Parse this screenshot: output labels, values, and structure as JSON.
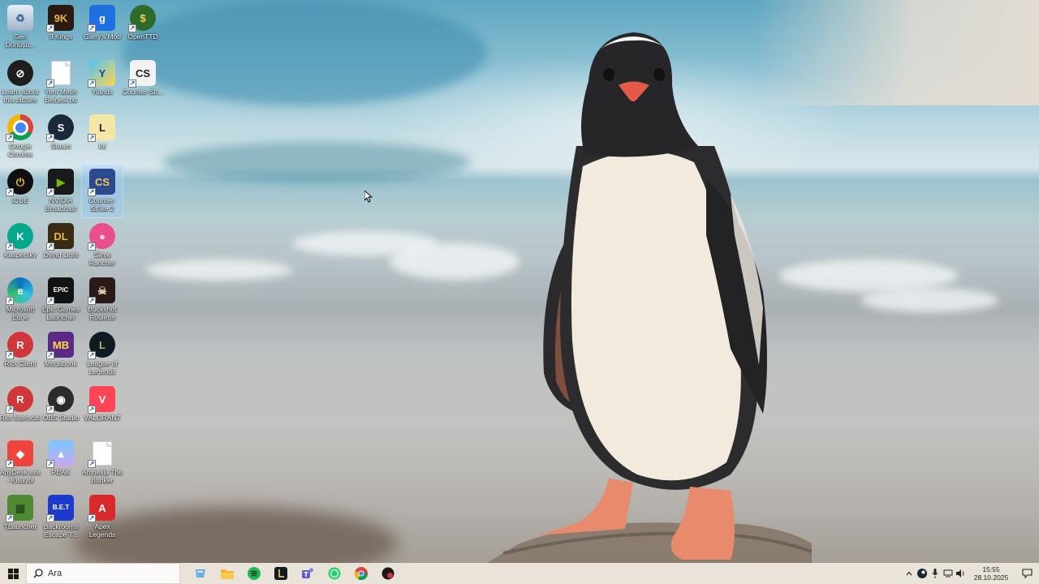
{
  "desktop": {
    "icons": [
      {
        "label": "Geri Dönüşü...",
        "icon": "recycle-bin-icon"
      },
      {
        "label": "9 Kings",
        "icon": "9-kings-icon"
      },
      {
        "label": "Garry's Mod",
        "icon": "garrys-mod-icon"
      },
      {
        "label": "OpenTTD",
        "icon": "openttd-icon"
      },
      {
        "label": "Learn about this picture",
        "icon": "learn-about-picture-icon"
      },
      {
        "label": "Yeni Metin Belgesi.txt",
        "icon": "text-document-icon"
      },
      {
        "label": "Ylands",
        "icon": "ylands-icon"
      },
      {
        "label": "Counter-Str...",
        "icon": "counter-strike-icon"
      },
      {
        "label": "Google Chrome",
        "icon": "chrome-icon"
      },
      {
        "label": "Steam",
        "icon": "steam-icon"
      },
      {
        "label": "lol",
        "icon": "lol-folder-icon"
      },
      {
        "label": "iCUE",
        "icon": "icue-icon"
      },
      {
        "label": "NVIDIA Broadcast",
        "icon": "nvidia-broadcast-icon"
      },
      {
        "label": "Counter-Strike 2",
        "icon": "counter-strike-2-icon"
      },
      {
        "label": "Kaspersky",
        "icon": "kaspersky-icon"
      },
      {
        "label": "Dying Light",
        "icon": "dying-light-icon"
      },
      {
        "label": "Slime Rancher",
        "icon": "slime-rancher-icon"
      },
      {
        "label": "Microsoft Edge",
        "icon": "edge-icon"
      },
      {
        "label": "Epic Games Launcher",
        "icon": "epic-games-icon"
      },
      {
        "label": "Buckshot Roulette",
        "icon": "buckshot-roulette-icon"
      },
      {
        "label": "Riot Client",
        "icon": "riot-client-icon"
      },
      {
        "label": "Megabonk",
        "icon": "megabonk-icon"
      },
      {
        "label": "League of Legends",
        "icon": "league-of-legends-icon"
      },
      {
        "label": "Riot İstemcisi",
        "icon": "riot-client-icon"
      },
      {
        "label": "OBS Studio",
        "icon": "obs-studio-icon"
      },
      {
        "label": "VALORANT",
        "icon": "valorant-icon"
      },
      {
        "label": "AnyDesk.exe - Kısayol",
        "icon": "anydesk-icon"
      },
      {
        "label": "PEAK",
        "icon": "peak-icon"
      },
      {
        "label": "Amnesia The Bunker",
        "icon": "text-document-icon"
      },
      {
        "label": "TLauncher",
        "icon": "tlauncher-icon"
      },
      {
        "label": "Backrooms Escape T...",
        "icon": "backrooms-icon"
      },
      {
        "label": "Apex Legends",
        "icon": "apex-legends-icon"
      }
    ],
    "icon_glyphs": {
      "9kings": "9K",
      "gmod": "g",
      "openttd": "$",
      "counter": "CS",
      "ylands": "Y",
      "steam": "S",
      "lol": "L",
      "icue": "⏻",
      "nvidia": "▶",
      "kaspersky": "K",
      "dying": "DL",
      "slime": "●",
      "epic": "EPIC",
      "buckshot": "☠",
      "riot": "R",
      "megabonk": "MB",
      "league": "L",
      "obs": "◉",
      "valorant": "V",
      "anydesk": "◆",
      "peak": "▲",
      "tlauncher": "▦",
      "bet": "B.E.T",
      "apex": "A"
    },
    "selected_icon": "Counter-Strike 2"
  },
  "taskbar": {
    "search_placeholder": "Ara",
    "pinned_apps": [
      "file-explorer-icon",
      "folder-icon",
      "spotify-icon",
      "league-of-legends-icon",
      "teams-icon",
      "whatsapp-icon",
      "chrome-icon",
      "riot-client-icon"
    ],
    "tray": {
      "time": "15:55",
      "date": "28.10.2025"
    }
  },
  "colors": {
    "taskbar_bg": "#e9e3da",
    "selection": "#99ccff"
  }
}
